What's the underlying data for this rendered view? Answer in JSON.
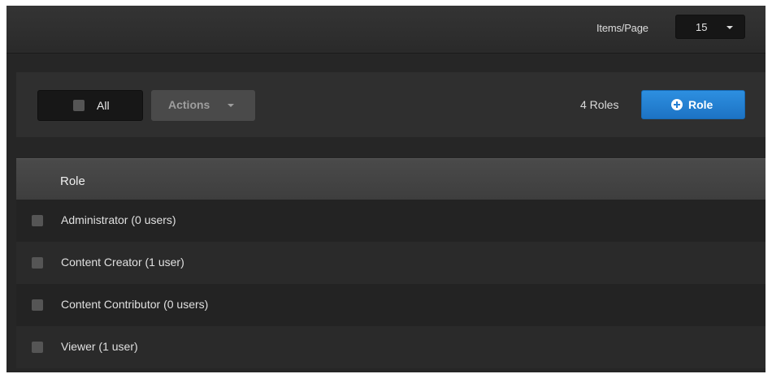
{
  "header": {
    "items_per_page_label": "Items/Page",
    "items_per_page_value": "15"
  },
  "toolbar": {
    "select_all_label": "All",
    "actions_label": "Actions",
    "roles_count": "4 Roles",
    "add_role_label": "Role"
  },
  "table": {
    "column_header": "Role",
    "rows": [
      {
        "label": "Administrator  (0 users)"
      },
      {
        "label": "Content Creator  (1 user)"
      },
      {
        "label": "Content Contributor  (0 users)"
      },
      {
        "label": "Viewer  (1 user)"
      }
    ]
  },
  "colors": {
    "accent": "#2680d4",
    "background": "#262626"
  }
}
